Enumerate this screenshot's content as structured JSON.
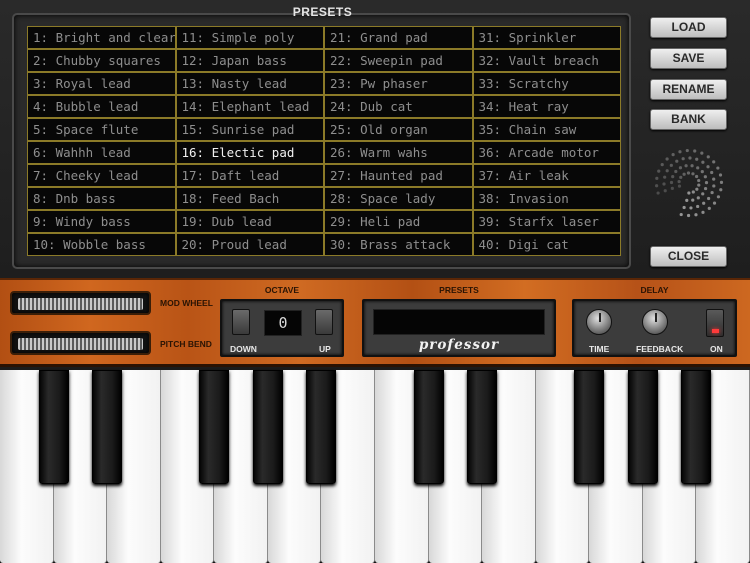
{
  "panel": {
    "title": "PRESETS"
  },
  "presets": [
    "1: Bright and clear",
    "2: Chubby squares",
    "3: Royal lead",
    "4: Bubble lead",
    "5: Space flute",
    "6: Wahhh lead",
    "7: Cheeky lead",
    "8: Dnb bass",
    "9: Windy bass",
    "10: Wobble bass",
    "11: Simple poly",
    "12: Japan bass",
    "13: Nasty lead",
    "14: Elephant lead",
    "15: Sunrise pad",
    "16: Electic pad",
    "17: Daft lead",
    "18: Feed Bach",
    "19: Dub lead",
    "20: Proud lead",
    "21: Grand pad",
    "22: Sweepin pad",
    "23: Pw phaser",
    "24: Dub cat",
    "25: Old organ",
    "26: Warm wahs",
    "27: Haunted pad",
    "28: Space lady",
    "29: Heli pad",
    "30: Brass attack",
    "31: Sprinkler",
    "32: Vault breach",
    "33: Scratchy",
    "34: Heat ray",
    "35: Chain saw",
    "36: Arcade motor",
    "37: Air leak",
    "38: Invasion",
    "39: Starfx laser",
    "40: Digi cat"
  ],
  "selected_preset_index": 15,
  "buttons": {
    "load": "LOAD",
    "save": "SAVE",
    "rename": "RENAME",
    "bank": "BANK",
    "close": "CLOSE"
  },
  "controls": {
    "mod_wheel": "MOD WHEEL",
    "pitch_bend": "PITCH BEND",
    "octave": {
      "title": "OCTAVE",
      "down": "DOWN",
      "up": "UP",
      "value": "0"
    },
    "presets": {
      "title": "PRESETS",
      "brand": "professor"
    },
    "delay": {
      "title": "DELAY",
      "time": "TIME",
      "feedback": "FEEDBACK",
      "on": "ON"
    }
  },
  "colors": {
    "cell_border": "#8b7a28",
    "wood": "#c45e1b",
    "led": "#ff3a3a"
  }
}
